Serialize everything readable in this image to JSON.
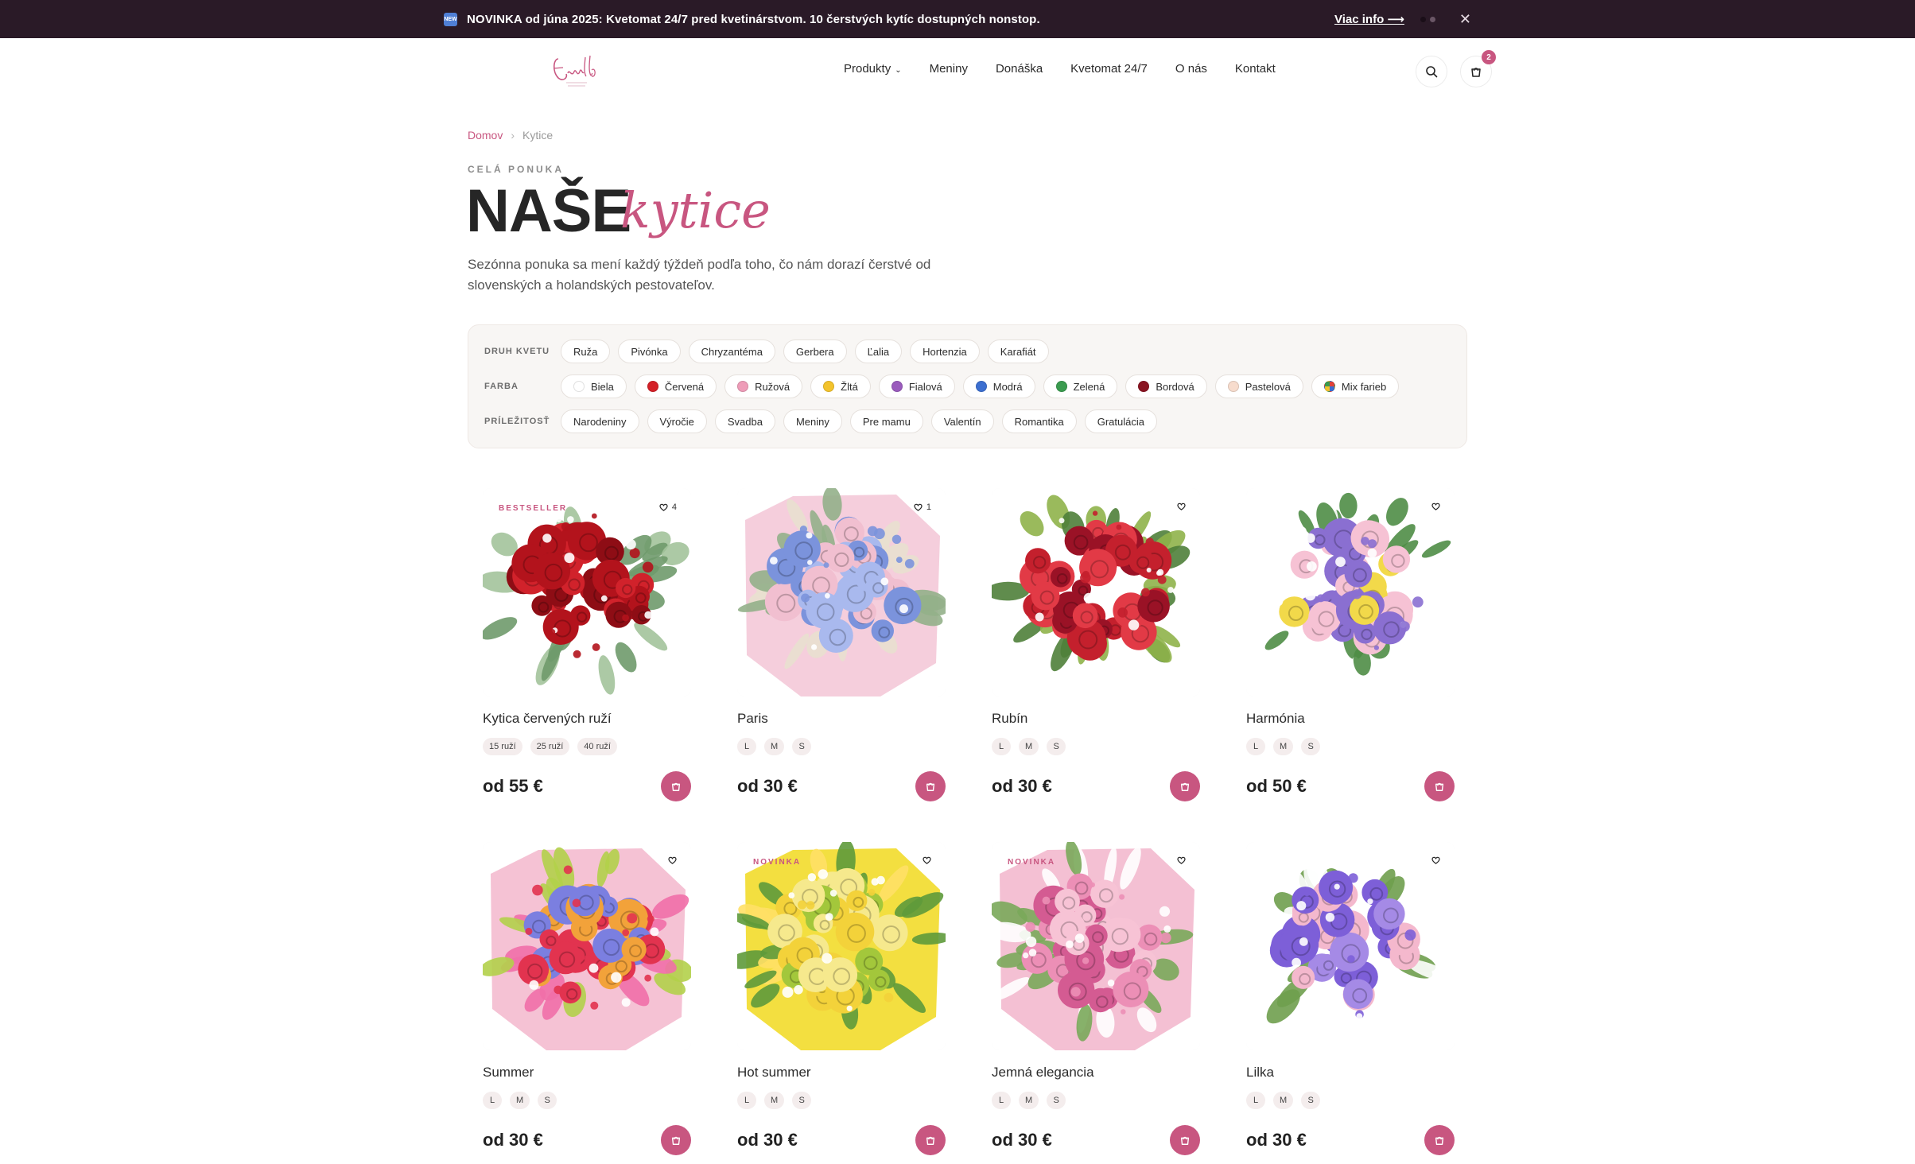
{
  "announcement": {
    "badge": "NEW",
    "text": "NOVINKA od júna 2025: Kvetomat 24/7 pred kvetinárstvom. 10 čerstvých kytíc dostupných nonstop.",
    "link": "Viac info ⟶",
    "close": "✕"
  },
  "header": {
    "nav": [
      "Produkty",
      "Meniny",
      "Donáška",
      "Kvetomat 24/7",
      "O nás",
      "Kontakt"
    ],
    "nav_chevron": "⌄",
    "cart_count": "2"
  },
  "breadcrumb": {
    "home": "Domov",
    "separator": "›",
    "current": "Kytice"
  },
  "hero": {
    "eyebrow": "CELÁ PONUKA",
    "title": "NAŠE",
    "script": "kytice",
    "description": "Sezónna ponuka sa mení každý týždeň podľa toho, čo nám dorazí čerstvé od slovenských a holandských pestovateľov."
  },
  "filters": {
    "flower": {
      "label": "DRUH KVETU",
      "options": [
        "Ruža",
        "Pivónka",
        "Chryzantéma",
        "Gerbera",
        "Ľalia",
        "Hortenzia",
        "Karafiát"
      ]
    },
    "color": {
      "label": "FARBA",
      "options": [
        {
          "name": "Biela",
          "color": "#ffffff"
        },
        {
          "name": "Červená",
          "color": "#d42027"
        },
        {
          "name": "Ružová",
          "color": "#ee9cb8"
        },
        {
          "name": "Žltá",
          "color": "#f3c32c"
        },
        {
          "name": "Fialová",
          "color": "#9a5bbd"
        },
        {
          "name": "Modrá",
          "color": "#3c6fd0"
        },
        {
          "name": "Zelená",
          "color": "#3a9b4f"
        },
        {
          "name": "Bordová",
          "color": "#8a1421"
        },
        {
          "name": "Pastelová",
          "color": "#f7dccd"
        },
        {
          "name": "Mix farieb",
          "color": "#e56b3a"
        }
      ]
    },
    "occasion": {
      "label": "PRÍLEŽITOSŤ",
      "options": [
        "Narodeniny",
        "Výročie",
        "Svadba",
        "Meniny",
        "Pre mamu",
        "Valentín",
        "Romantika",
        "Gratulácia"
      ]
    }
  },
  "products": [
    {
      "name": "Kytica červených ruží",
      "tag": "BESTSELLER",
      "likes": "4",
      "sizes": [
        "15 ruží",
        "25 ruží",
        "40 ruží"
      ],
      "price": "od 55 €",
      "palette": [
        "#b3131c",
        "#d1222b",
        "#8e0d15",
        "#6f9a6c",
        "#a3c39b"
      ],
      "wrap": "#ffffff"
    },
    {
      "name": "Paris",
      "tag": "",
      "likes": "1",
      "sizes": [
        "L",
        "M",
        "S"
      ],
      "price": "od 30 €",
      "palette": [
        "#7b93dc",
        "#a9b9ee",
        "#f1bfd0",
        "#e9e0cf",
        "#94b08a"
      ],
      "wrap": "#f3c6d6"
    },
    {
      "name": "Rubín",
      "tag": "",
      "likes": "",
      "sizes": [
        "L",
        "M",
        "S"
      ],
      "price": "od 30 €",
      "palette": [
        "#c4202d",
        "#9a1226",
        "#e23a46",
        "#8fb34a",
        "#4f7f3a"
      ],
      "wrap": "#ffffff"
    },
    {
      "name": "Harmónia",
      "tag": "",
      "likes": "",
      "sizes": [
        "L",
        "M",
        "S"
      ],
      "price": "od 50 €",
      "palette": [
        "#8a6fd1",
        "#f2d94a",
        "#f6c2d4",
        "#ffffff",
        "#4f8d46"
      ],
      "wrap": "#ffffff"
    },
    {
      "name": "Summer",
      "tag": "",
      "likes": "",
      "sizes": [
        "L",
        "M",
        "S"
      ],
      "price": "od 30 €",
      "palette": [
        "#e2334f",
        "#f2a23a",
        "#7b7fe0",
        "#f16fa9",
        "#b2d04a"
      ],
      "wrap": "#f3b7cc"
    },
    {
      "name": "Hot summer",
      "tag": "NOVINKA",
      "likes": "",
      "sizes": [
        "L",
        "M",
        "S"
      ],
      "price": "od 30 €",
      "palette": [
        "#f3d23a",
        "#a3c73b",
        "#f6e98d",
        "#5e9a3b",
        "#ffe066"
      ],
      "wrap": "#f1d91e"
    },
    {
      "name": "Jemná elegancia",
      "tag": "NOVINKA",
      "likes": "",
      "sizes": [
        "L",
        "M",
        "S"
      ],
      "price": "od 30 €",
      "palette": [
        "#ec8fb6",
        "#f7c3d5",
        "#d45b92",
        "#ffffff",
        "#7aa85a"
      ],
      "wrap": "#f2b5cb"
    },
    {
      "name": "Lilka",
      "tag": "",
      "likes": "",
      "sizes": [
        "L",
        "M",
        "S"
      ],
      "price": "od 30 €",
      "palette": [
        "#7d5fd8",
        "#a58ae6",
        "#f4b8cd",
        "#ffffff",
        "#6f9f4e"
      ],
      "wrap": "#ffffff"
    }
  ]
}
